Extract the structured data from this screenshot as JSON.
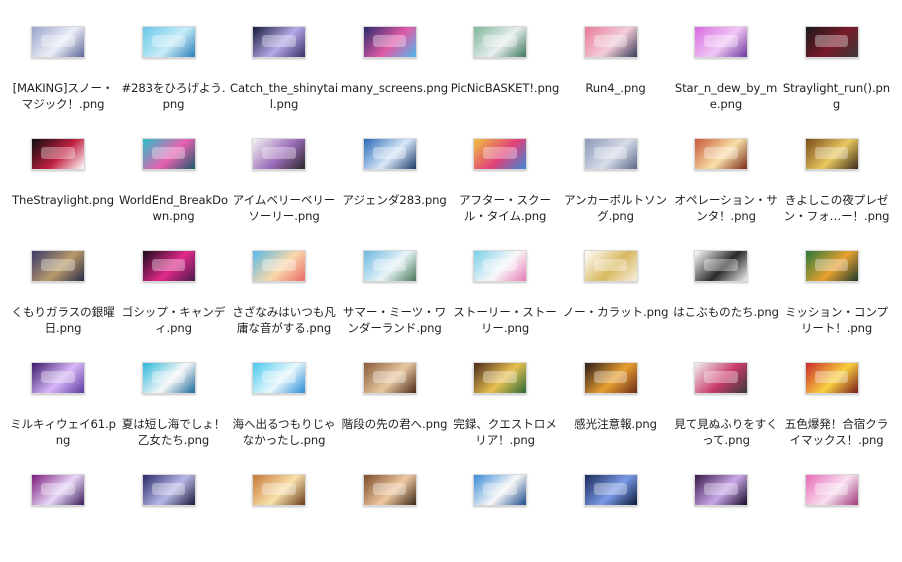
{
  "finder": {
    "files": [
      {
        "name": "[MAKING]スノー・マジック！.png",
        "thumb": [
          "#9aa3c8",
          "#eceff8",
          "#5c6796"
        ]
      },
      {
        "name": "#283をひろげよう.png",
        "thumb": [
          "#68c6e8",
          "#c7ecf7",
          "#2b7fb8"
        ]
      },
      {
        "name": "Catch_the_shinytail.png",
        "thumb": [
          "#161c3c",
          "#b6a9e8",
          "#3a2f66"
        ]
      },
      {
        "name": "many_screens.png",
        "thumb": [
          "#2a2a6a",
          "#e05aa8",
          "#4fb8e8"
        ]
      },
      {
        "name": "PicNicBASKET!.png",
        "thumb": [
          "#7fb89a",
          "#e8eef0",
          "#3d7a5a"
        ]
      },
      {
        "name": "Run4_.png",
        "thumb": [
          "#e87a9a",
          "#f3cdd8",
          "#3a3a5a"
        ]
      },
      {
        "name": "Star_n_dew_by_me.png",
        "thumb": [
          "#d86ae0",
          "#f1c7f5",
          "#6a3aa0"
        ]
      },
      {
        "name": "Straylight_run().png",
        "thumb": [
          "#1a1a1a",
          "#7a1a2a",
          "#3a3a3a"
        ]
      },
      {
        "name": "TheStraylight.png",
        "thumb": [
          "#0d0d0d",
          "#c02040",
          "#ffffff"
        ]
      },
      {
        "name": "WorldEnd_BreakDown.png",
        "thumb": [
          "#2ac0c8",
          "#e860b0",
          "#1a5a6a"
        ]
      },
      {
        "name": "アイムベリーベリーソーリー.png",
        "thumb": [
          "#f4f4f4",
          "#9a6ab8",
          "#2a2a2a"
        ]
      },
      {
        "name": "アジェンダ283.png",
        "thumb": [
          "#2a6ab8",
          "#d8e8f8",
          "#1a3a6a"
        ]
      },
      {
        "name": "アフター・スクール・タイム.png",
        "thumb": [
          "#f0c040",
          "#e0407a",
          "#3a8ad8"
        ]
      },
      {
        "name": "アンカーボルトソング.png",
        "thumb": [
          "#8a9ab8",
          "#d8dce8",
          "#5a6a8a"
        ]
      },
      {
        "name": "オペレーション・サンタ！.png",
        "thumb": [
          "#c8583a",
          "#f8e0a8",
          "#7a2a1a"
        ]
      },
      {
        "name": "きよしこの夜プレゼン・フォ…ー！.png",
        "thumb": [
          "#7a4a1a",
          "#e8c860",
          "#3a2a1a"
        ]
      },
      {
        "name": "くもりガラスの銀曜日.png",
        "thumb": [
          "#3a3a6a",
          "#b89a6a",
          "#2a2a4a"
        ]
      },
      {
        "name": "ゴシップ・キャンディ.png",
        "thumb": [
          "#1a0a1a",
          "#e02a8a",
          "#4a1a4a"
        ]
      },
      {
        "name": "さざなみはいつも凡庸な音がする.png",
        "thumb": [
          "#5ab8e8",
          "#f8d8a8",
          "#e86a6a"
        ]
      },
      {
        "name": "サマー・ミーツ・ワンダーランド.png",
        "thumb": [
          "#6ab8e0",
          "#e8f4f8",
          "#4a7a5a"
        ]
      },
      {
        "name": "ストーリー・ストーリー.png",
        "thumb": [
          "#7ad0e8",
          "#f8f8f8",
          "#e87ab8"
        ]
      },
      {
        "name": "ノー・カラット.png",
        "thumb": [
          "#ffffff",
          "#d8b860",
          "#f8f0e0"
        ]
      },
      {
        "name": "はこぶものたち.png",
        "thumb": [
          "#ffffff",
          "#2a2a2a",
          "#f0f0f0"
        ]
      },
      {
        "name": "ミッション・コンプリート！.png",
        "thumb": [
          "#2a7a3a",
          "#e8a030",
          "#1a3a2a"
        ]
      },
      {
        "name": "ミルキィウェイ61.png",
        "thumb": [
          "#3a1a6a",
          "#d8b8f8",
          "#5a3aa0"
        ]
      },
      {
        "name": "夏は短し海でしょ！乙女たち.png",
        "thumb": [
          "#2ab8d8",
          "#f8f8f8",
          "#1a6a9a"
        ]
      },
      {
        "name": "海へ出るつもりじゃなかったし.png",
        "thumb": [
          "#4ac8f0",
          "#e8f8fc",
          "#2a8ad8"
        ]
      },
      {
        "name": "階段の先の君へ.png",
        "thumb": [
          "#8a5a3a",
          "#e8c8a0",
          "#4a2a1a"
        ]
      },
      {
        "name": "完録、クエストロメリア！.png",
        "thumb": [
          "#4a2a1a",
          "#e8c050",
          "#2a6a3a"
        ]
      },
      {
        "name": "感光注意報.png",
        "thumb": [
          "#2a1a1a",
          "#e8a030",
          "#6a2a1a"
        ]
      },
      {
        "name": "見て見ぬふりをすくって.png",
        "thumb": [
          "#f0f0f0",
          "#c83a6a",
          "#3a3a3a"
        ]
      },
      {
        "name": "五色爆発！合宿クライマックス！.png",
        "thumb": [
          "#c82a2a",
          "#f8d040",
          "#7a1a1a"
        ]
      },
      {
        "name": "",
        "thumb": [
          "#7a1a7a",
          "#e8d8f8",
          "#3a1a5a"
        ]
      },
      {
        "name": "",
        "thumb": [
          "#2a2a6a",
          "#b8b8e8",
          "#1a1a3a"
        ]
      },
      {
        "name": "",
        "thumb": [
          "#c8783a",
          "#f8e0a8",
          "#6a3a1a"
        ]
      },
      {
        "name": "",
        "thumb": [
          "#7a4a2a",
          "#f0c8a0",
          "#3a2a1a"
        ]
      },
      {
        "name": "",
        "thumb": [
          "#3a8ad8",
          "#f8f8f8",
          "#1a4a8a"
        ]
      },
      {
        "name": "",
        "thumb": [
          "#1a2a5a",
          "#7a9ae8",
          "#0a1a3a"
        ]
      },
      {
        "name": "",
        "thumb": [
          "#3a1a4a",
          "#c8a8e8",
          "#1a0a2a"
        ]
      },
      {
        "name": "",
        "thumb": [
          "#e86ab8",
          "#f8e0f0",
          "#a03a7a"
        ]
      }
    ]
  }
}
